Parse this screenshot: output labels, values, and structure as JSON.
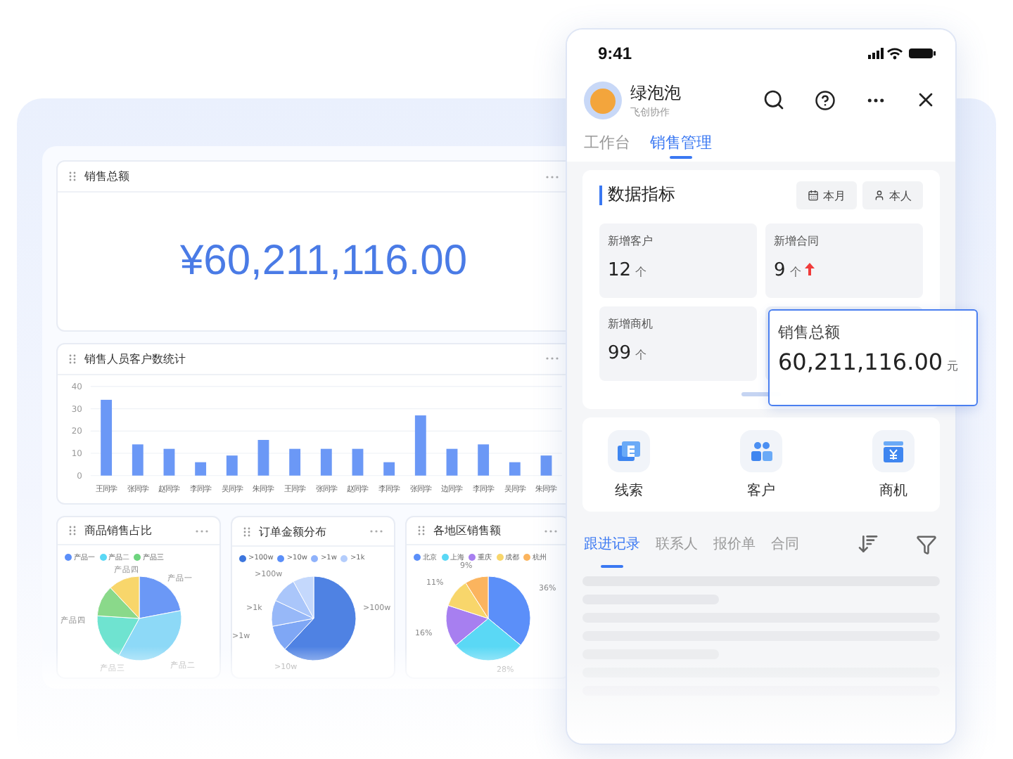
{
  "dashboard": {
    "total_card": {
      "title": "销售总额",
      "value": "¥60,211,116.00"
    },
    "bar_card": {
      "title": "销售人员客户数统计",
      "chart_data": {
        "type": "bar",
        "categories": [
          "王同学",
          "张同学",
          "赵同学",
          "李同学",
          "吴同学",
          "朱同学",
          "王同学",
          "张同学",
          "赵同学",
          "李同学",
          "张同学",
          "边同学",
          "李同学",
          "吴同学",
          "朱同学"
        ],
        "values": [
          34,
          14,
          12,
          6,
          9,
          16,
          12,
          12,
          12,
          6,
          27,
          12,
          14,
          6,
          9
        ],
        "yticks": [
          0,
          10,
          20,
          30,
          40
        ],
        "ylim": [
          0,
          40
        ],
        "grid": true
      }
    },
    "pie_cards": [
      {
        "title": "商品销售占比",
        "legend": [
          {
            "label": "产品一",
            "color": "#5b8ff9"
          },
          {
            "label": "产品二",
            "color": "#5ad8f5"
          },
          {
            "label": "产品三",
            "color": "#6dd47e"
          }
        ],
        "slice_labels": [
          "产品一",
          "产品二",
          "产品三",
          "产品四",
          "产品四"
        ]
      },
      {
        "title": "订单金额分布",
        "legend": [
          {
            "label": ">100w",
            "color": "#3d76dd"
          },
          {
            "label": ">10w",
            "color": "#5b8ff9"
          },
          {
            "label": ">1w",
            "color": "#8fb2fb"
          },
          {
            "label": ">1k",
            "color": "#b4cdfc"
          }
        ],
        "slice_labels": [
          ">100w",
          ">10w",
          ">1w",
          ">1k",
          ">100w"
        ]
      },
      {
        "title": "各地区销售额",
        "legend": [
          {
            "color": "#5b8ff9"
          },
          {
            "color": "#5ad8f5"
          },
          {
            "color": "#a77ff0"
          },
          {
            "color": "#f8d66b"
          },
          {
            "color": "#fbb45e"
          }
        ],
        "chart_data": {
          "type": "pie",
          "categories": [
            "北京",
            "上海",
            "重庆",
            "成都",
            "杭州"
          ],
          "values": [
            36,
            28,
            16,
            11,
            9
          ],
          "value_labels": [
            "36%",
            "28%",
            "16%",
            "11%",
            "9%"
          ]
        }
      }
    ]
  },
  "phone": {
    "time": "9:41",
    "app_name": "绿泡泡",
    "app_subtitle": "飞创协作",
    "tabs": [
      {
        "label": "工作台",
        "selected": false
      },
      {
        "label": "销售管理",
        "selected": true
      }
    ],
    "metrics_card": {
      "title": "数据指标",
      "filters": [
        "本月",
        "本人"
      ],
      "metrics": [
        {
          "label": "新增客户",
          "value": "12",
          "unit": "个",
          "trend_up": false
        },
        {
          "label": "新增合同",
          "value": "9",
          "unit": "个",
          "trend_up": true
        },
        {
          "label": "新增商机",
          "value": "99",
          "unit": "个",
          "trend_up": false
        }
      ],
      "dragged_metric": {
        "label": "销售总额",
        "value": "60,211,116.00",
        "unit": "元"
      }
    },
    "shortcuts": [
      {
        "kind": "leads",
        "label": "线索"
      },
      {
        "kind": "customers",
        "label": "客户"
      },
      {
        "kind": "deals",
        "label": "商机"
      }
    ],
    "record_tabs": [
      {
        "label": "跟进记录",
        "selected": true
      },
      {
        "label": "联系人",
        "selected": false
      },
      {
        "label": "报价单",
        "selected": false
      },
      {
        "label": "合同",
        "selected": false
      }
    ]
  }
}
